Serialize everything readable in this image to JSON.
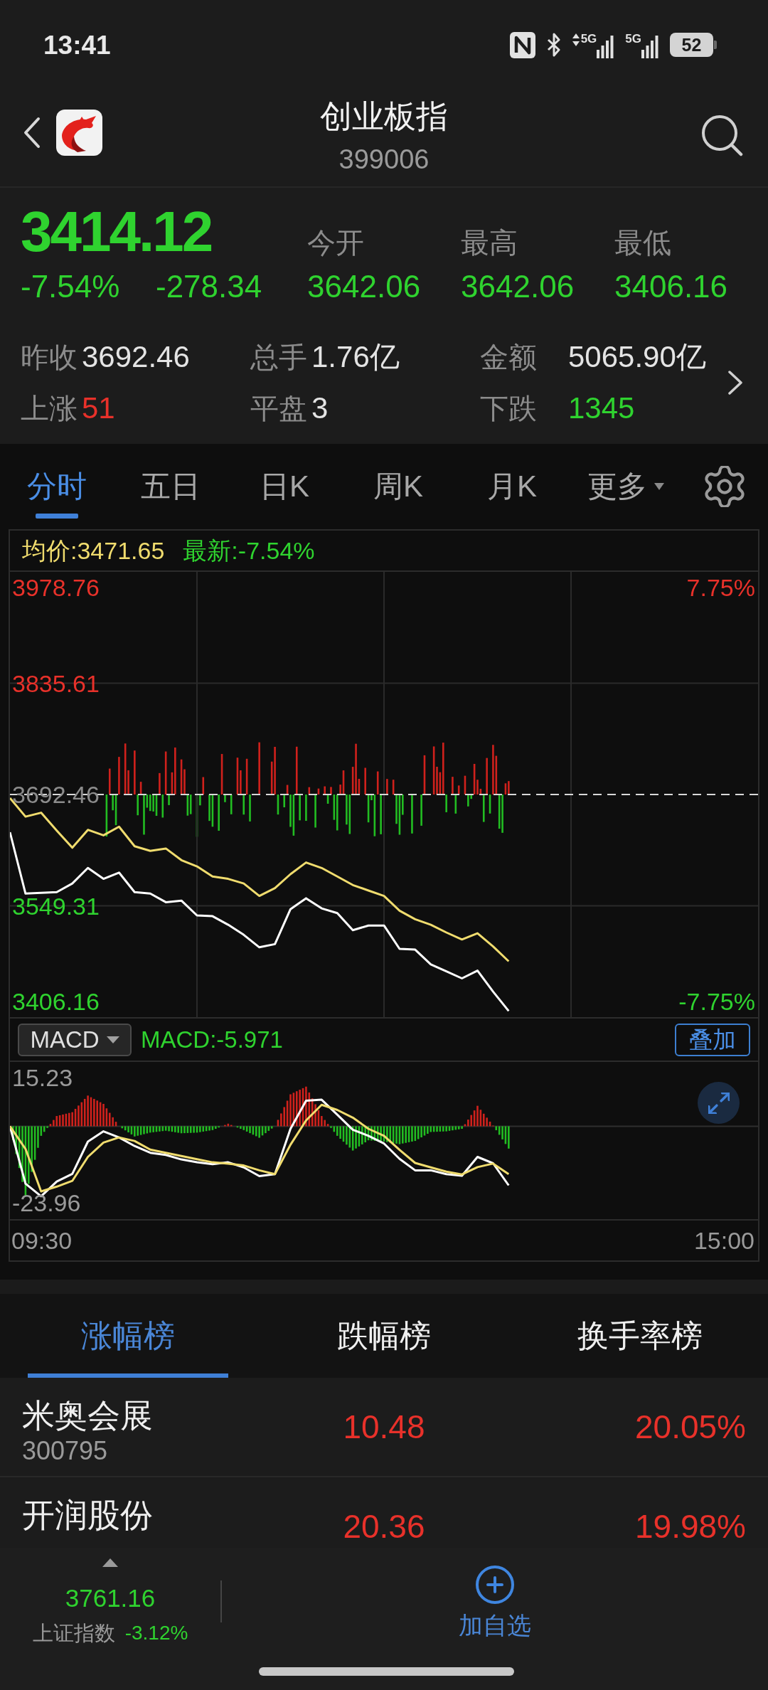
{
  "status_bar": {
    "time": "13:41",
    "networks": [
      {
        "label": "5G",
        "data_arrows": true
      },
      {
        "label": "5G",
        "data_arrows": false
      }
    ],
    "battery": "52"
  },
  "header": {
    "title": "创业板指",
    "code": "399006"
  },
  "quote": {
    "price": "3414.12",
    "color": "#2fd32f",
    "change_pct": "-7.54%",
    "change": "-278.34",
    "stats": [
      {
        "label": "今开",
        "value": "3642.06",
        "color": "#2fd32f"
      },
      {
        "label": "最高",
        "value": "3642.06",
        "color": "#2fd32f"
      },
      {
        "label": "最低",
        "value": "3406.16",
        "color": "#2fd32f"
      }
    ],
    "details": [
      {
        "label": "昨收",
        "value": "3692.46",
        "color": "#e4e4e4"
      },
      {
        "label": "总手",
        "value": "1.76亿",
        "color": "#e4e4e4"
      },
      {
        "label": "金额",
        "value": "5065.90亿",
        "color": "#e4e4e4"
      },
      {
        "label": "上涨",
        "value": "51",
        "color": "#e8312a"
      },
      {
        "label": "平盘",
        "value": "3",
        "color": "#e4e4e4"
      },
      {
        "label": "下跌",
        "value": "1345",
        "color": "#2fd32f"
      }
    ]
  },
  "chart_tabs": [
    {
      "label": "分时",
      "selected": true,
      "kind": "tab"
    },
    {
      "label": "五日",
      "selected": false,
      "kind": "tab"
    },
    {
      "label": "日K",
      "selected": false,
      "kind": "tab"
    },
    {
      "label": "周K",
      "selected": false,
      "kind": "tab"
    },
    {
      "label": "月K",
      "selected": false,
      "kind": "tab"
    },
    {
      "label": "更多",
      "selected": false,
      "kind": "dropdown"
    }
  ],
  "price_chart": {
    "legend": [
      {
        "text": "均价:3471.65",
        "color": "#f0dc6e"
      },
      {
        "text": "最新:-7.54%",
        "color": "#2fd32f"
      }
    ],
    "pct_labels": [
      {
        "text": "7.75%",
        "color": "#e8312a"
      },
      {
        "text": "-7.75%",
        "color": "#2fd32f"
      }
    ],
    "chart_data": {
      "type": "line",
      "grid": true,
      "categories": [
        null,
        null,
        null,
        null,
        null,
        null,
        null,
        null,
        null,
        null,
        null,
        null,
        null,
        null,
        null,
        null,
        null,
        null,
        null,
        null,
        null,
        null,
        null,
        null,
        null,
        null,
        null,
        null,
        null,
        null,
        null,
        null,
        null,
        null,
        null,
        null,
        null,
        null,
        null,
        null,
        null,
        null,
        null,
        null,
        null,
        null,
        null,
        null,
        null
      ],
      "ylim": [
        3406.16,
        3978.76
      ],
      "yticks": [
        {
          "value": 3406.16,
          "label": "3406.16"
        },
        {
          "value": 3549.31,
          "label": "3549.31"
        },
        {
          "value": 3692.46,
          "label": "3692.46"
        },
        {
          "value": 3835.61,
          "label": "3835.61"
        },
        {
          "value": 3978.76,
          "label": "3978.76"
        }
      ],
      "ref_lines": [
        {
          "axis": "y",
          "value": 3692.46
        }
      ],
      "series": [
        {
          "color": "#ffffff",
          "values": [
            3644,
            3565,
            3566,
            3567,
            3578,
            3598,
            3584,
            3592,
            3567,
            3565,
            3554,
            3556,
            3537,
            3536,
            3525,
            3512,
            3496,
            3500,
            3545,
            3559,
            3546,
            3540,
            3518,
            3524,
            3524,
            3494,
            3493,
            3474,
            3465,
            3456,
            3466,
            3439,
            3414,
            null,
            null,
            null,
            null,
            null,
            null,
            null,
            null,
            null,
            null,
            null,
            null,
            null,
            null,
            null,
            null
          ]
        },
        {
          "color": "#f0dc6e",
          "values": [
            3688,
            3664,
            3669,
            3646,
            3624,
            3647,
            3640,
            3651,
            3626,
            3620,
            3623,
            3608,
            3600,
            3587,
            3584,
            3578,
            3562,
            3572,
            3590,
            3605,
            3598,
            3587,
            3576,
            3569,
            3562,
            3543,
            3532,
            3525,
            3515,
            3506,
            3514,
            3497,
            3478,
            null,
            null,
            null,
            null,
            null,
            null,
            null,
            null,
            null,
            null,
            null,
            null,
            null,
            null,
            null,
            null
          ]
        }
      ]
    }
  },
  "macd": {
    "indicator": "MACD",
    "reading": {
      "text": "MACD:-5.971",
      "color": "#2fd32f"
    },
    "overlay_button": "叠加",
    "chart_data": {
      "type": "line",
      "grid": true,
      "categories": [
        null,
        null,
        null,
        null,
        null,
        null,
        null,
        null,
        null,
        null,
        null,
        null,
        null,
        null,
        null,
        null,
        null,
        null,
        null,
        null,
        null,
        null,
        null,
        null,
        null,
        null,
        null,
        null,
        null,
        null,
        null,
        null,
        null,
        null,
        null,
        null,
        null,
        null,
        null,
        null,
        null,
        null,
        null,
        null,
        null,
        null,
        null,
        null,
        null
      ],
      "ylim": [
        -42.44,
        15.23
      ],
      "yticks": [
        {
          "value": -23.96,
          "label": "-23.96"
        },
        {
          "value": 15.23,
          "label": "15.23"
        }
      ],
      "series": [
        {
          "color": "#ffffff",
          "values": [
            0,
            -18.0,
            -21.9,
            -17.3,
            -14.9,
            -4.8,
            -1.6,
            -3.5,
            -6.2,
            -8.3,
            -9.0,
            -10.4,
            -11.3,
            -11.9,
            -11.3,
            -12.9,
            -15.6,
            -15.0,
            -0.8,
            8.0,
            8.3,
            3.6,
            -1.1,
            -3.0,
            -5.4,
            -10.2,
            -13.8,
            -13.8,
            -15.0,
            -15.5,
            -9.6,
            -11.6,
            -18.5,
            null,
            null,
            null,
            null,
            null,
            null,
            null,
            null,
            null,
            null,
            null,
            null,
            null,
            null,
            null,
            null
          ]
        },
        {
          "color": "#f0dc6e",
          "values": [
            0,
            -7.1,
            -20.4,
            -18.9,
            -17.1,
            -9.6,
            -5.1,
            -3.5,
            -4.6,
            -7.3,
            -8.3,
            -9.3,
            -10.3,
            -11.3,
            -11.7,
            -12.3,
            -13.8,
            -15.0,
            -5.8,
            1.8,
            6.7,
            5.1,
            2.7,
            -0.8,
            -3.0,
            -7.4,
            -11.5,
            -12.9,
            -14.2,
            -15.1,
            -12.8,
            -11.7,
            -15.0,
            null,
            null,
            null,
            null,
            null,
            null,
            null,
            null,
            null,
            null,
            null,
            null,
            null,
            null,
            null,
            null
          ]
        }
      ]
    },
    "time_labels": [
      "09:30",
      "15:00"
    ]
  },
  "ranking_tabs": [
    {
      "label": "涨幅榜",
      "selected": true
    },
    {
      "label": "跌幅榜",
      "selected": false
    },
    {
      "label": "换手率榜",
      "selected": false
    }
  ],
  "ranking_rows": [
    {
      "name": "米奥会展",
      "code": "300795",
      "price": "10.48",
      "change": "20.05%",
      "color": "#e8312a"
    },
    {
      "name": "开润股份",
      "price": "20.36",
      "change": "19.98%",
      "color": "#e8312a"
    }
  ],
  "bottom_bar": {
    "index": {
      "price": "3761.16",
      "name": "上证指数",
      "change": "-3.12%",
      "color": "#2fd32f"
    },
    "add_button": "加自选"
  }
}
